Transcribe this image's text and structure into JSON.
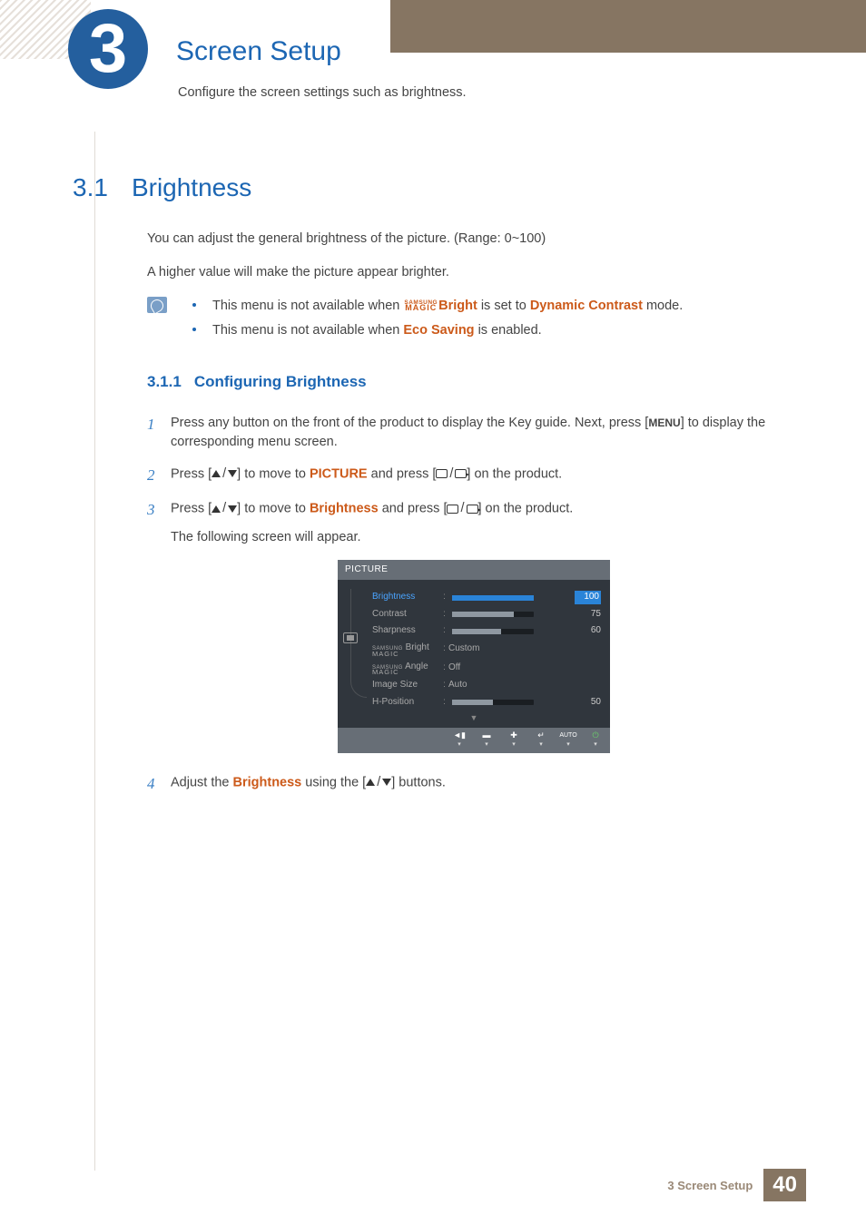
{
  "chapter": {
    "number": "3",
    "title": "Screen Setup",
    "desc": "Configure the screen settings such as brightness."
  },
  "section": {
    "num": "3.1",
    "title": "Brightness"
  },
  "intro": {
    "p1": "You can adjust the general brightness of the picture. (Range: 0~100)",
    "p2": "A higher value will make the picture appear brighter."
  },
  "notes": {
    "n1_a": "This menu is not available when ",
    "n1_bright": "Bright",
    "n1_b": " is set to ",
    "n1_mode": "Dynamic Contrast",
    "n1_c": " mode.",
    "n2_a": "This menu is not available when ",
    "n2_eco": "Eco Saving",
    "n2_b": " is enabled."
  },
  "subsection": {
    "num": "3.1.1",
    "title": "Configuring Brightness"
  },
  "steps": {
    "s1_a": "Press any button on the front of the product to display the Key guide. Next, press [",
    "s1_menu": "MENU",
    "s1_b": "] to display the corresponding menu screen.",
    "s2_a": "Press [",
    "s2_b": "] to move to ",
    "s2_pic": "PICTURE",
    "s2_c": " and press [",
    "s2_d": "] on the product.",
    "s3_a": "Press [",
    "s3_b": "] to move to ",
    "s3_br": "Brightness",
    "s3_c": " and press [",
    "s3_d": "] on the product.",
    "s3_e": "The following screen will appear.",
    "s4_a": "Adjust the ",
    "s4_br": "Brightness",
    "s4_b": " using the [",
    "s4_c": "] buttons."
  },
  "osd": {
    "title": "PICTURE",
    "rows": [
      {
        "label": "Brightness",
        "value": 100,
        "type": "bar",
        "selected": true
      },
      {
        "label": "Contrast",
        "value": 75,
        "type": "bar"
      },
      {
        "label": "Sharpness",
        "value": 60,
        "type": "bar"
      },
      {
        "label_magic": "Bright",
        "text": "Custom",
        "type": "text"
      },
      {
        "label_magic": "Angle",
        "text": "Off",
        "type": "text"
      },
      {
        "label": "Image Size",
        "text": "Auto",
        "type": "text"
      },
      {
        "label": "H-Position",
        "value": 50,
        "type": "bar"
      }
    ],
    "magic_top": "SAMSUNG",
    "magic_bot": "MAGIC",
    "foot_auto": "AUTO"
  },
  "footer": {
    "text": "3 Screen Setup",
    "page": "40"
  }
}
